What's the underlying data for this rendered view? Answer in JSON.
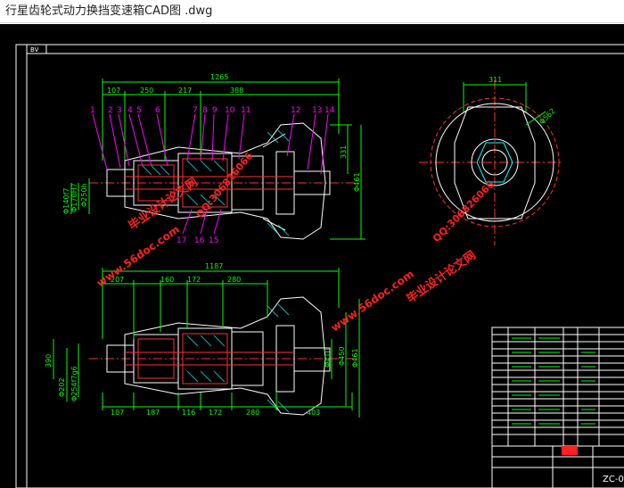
{
  "window": {
    "title": "行星齿轮式动力换挡变速箱CAD图 .dwg"
  },
  "colors": {
    "background": "#000000",
    "drawing": "#ffffff",
    "dimension": "#00ff00",
    "leader": "#ff00ff",
    "center": "#ff3030",
    "hatch": "#00ffff",
    "watermark": "#ff2020"
  },
  "frame": {
    "tag": "BV"
  },
  "top_view": {
    "dims_top": [
      "1265",
      "107",
      "250",
      "217",
      "388"
    ],
    "balloons": [
      "1",
      "2",
      "3",
      "4",
      "5",
      "6",
      "7",
      "8",
      "9",
      "10",
      "11",
      "12",
      "13",
      "14"
    ],
    "balloons_bottom": [
      "17",
      "16",
      "15"
    ],
    "dims_left": [
      "Φ140f7",
      "Φ170H7",
      "Φ250h"
    ],
    "dims_right": [
      "331",
      "Φ461"
    ]
  },
  "end_view": {
    "dim_top": "311",
    "dim_dia": "Φ562"
  },
  "bottom_view": {
    "dims_top": [
      "1187",
      "207",
      "160",
      "172",
      "280"
    ],
    "dims_bottom": [
      "107",
      "187",
      "116",
      "172",
      "280",
      "403"
    ],
    "dims_left": [
      "390",
      "Φ202",
      "Φ254f7g6"
    ],
    "dims_right": [
      "Φ410",
      "Φ450",
      "Φ461"
    ]
  },
  "watermarks": [
    "毕业设计论文网",
    "www.56doc.com",
    "QQ:306826066",
    "www.56doc.com",
    "QQ:306826066",
    "毕业设计论文网"
  ],
  "title_block": {
    "drawing_no": "ZC-0"
  }
}
